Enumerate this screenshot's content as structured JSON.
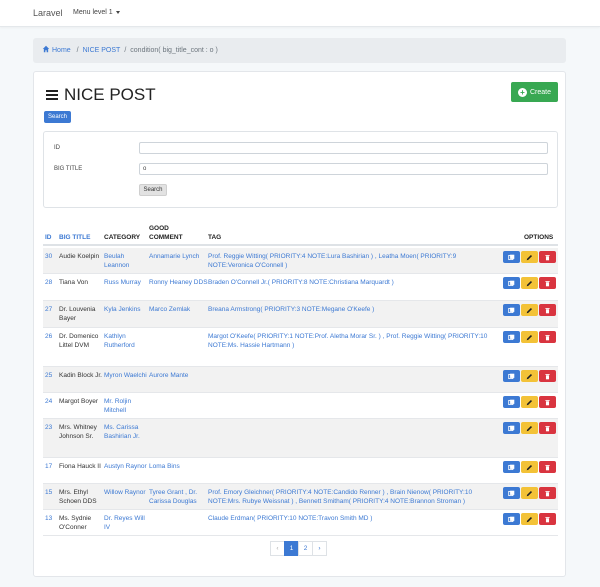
{
  "navbar": {
    "brand": "Laravel",
    "menu_label": "Menu level 1"
  },
  "breadcrumb": {
    "home": "Home",
    "page": "NICE POST",
    "current": "condition( big_title_cont : o )"
  },
  "header": {
    "title": "NICE POST",
    "create_label": "Create",
    "search_toggle_label": "Search"
  },
  "filter": {
    "id_label": "ID",
    "id_value": "",
    "big_title_label": "BIG TITLE",
    "big_title_value": "o",
    "search_button": "Search"
  },
  "table": {
    "headers": {
      "id": "ID",
      "big_title": "BIG TITLE",
      "category": "CATEGORY",
      "good_comment": "GOOD COMMENT",
      "tag": "TAG",
      "options": "OPTIONS"
    },
    "rows": [
      {
        "id": "30",
        "title": "Audie Koelpin",
        "category": "Beulah Leannon",
        "comment": "Annamarie Lynch",
        "tag": "Prof. Reggie Witting( PRIORITY:4 NOTE:Lura Bashirian ) , Leatha Moen( PRIORITY:9 NOTE:Veronica O'Connell )"
      },
      {
        "id": "28",
        "title": "Tiana Von",
        "category": "Russ Murray",
        "comment": "Ronny Heaney DDS",
        "tag": "Braden O'Connell Jr.( PRIORITY:8 NOTE:Christiana Marquardt )"
      },
      {
        "id": "27",
        "title": "Dr. Louvenia Bayer",
        "category": "Kyla Jenkins",
        "comment": "Marco Zemlak",
        "tag": "Breana Armstrong( PRIORITY:3 NOTE:Megane O'Keefe )"
      },
      {
        "id": "26",
        "title": "Dr. Domenico Littel DVM",
        "category": "Kathlyn Rutherford",
        "comment": "",
        "tag": "Margot O'Keefe( PRIORITY:1 NOTE:Prof. Aletha Morar Sr. ) , Prof. Reggie Witting( PRIORITY:10 NOTE:Ms. Hassie Hartmann )"
      },
      {
        "id": "25",
        "title": "Kadin Block Jr.",
        "category": "Myron Waelchi",
        "comment": "Aurore Mante",
        "tag": ""
      },
      {
        "id": "24",
        "title": "Margot Boyer",
        "category": "Mr. Roljin Mitchell",
        "comment": "",
        "tag": ""
      },
      {
        "id": "23",
        "title": "Mrs. Whitney Johnson Sr.",
        "category": "Ms. Carissa Bashirian Jr.",
        "comment": "",
        "tag": ""
      },
      {
        "id": "17",
        "title": "Fiona Hauck II",
        "category": "Austyn Raynor",
        "comment": "Loma Bins",
        "tag": ""
      },
      {
        "id": "15",
        "title": "Mrs. Ethyl Schoen DDS",
        "category": "Willow Raynor",
        "comment": "Tyree Grant , Dr. Carissa Douglas",
        "tag": "Prof. Emory Gleichner( PRIORITY:4 NOTE:Candido Renner ) , Brain Nienow( PRIORITY:10 NOTE:Mrs. Rubye Weissnat ) , Bennett Smitham( PRIORITY:4 NOTE:Brannon Stroman )"
      },
      {
        "id": "13",
        "title": "Ms. Sydnie O'Conner",
        "category": "Dr. Reyes Will IV",
        "comment": "",
        "tag": "Claude Erdman( PRIORITY:10 NOTE:Travon Smith MD )"
      }
    ]
  },
  "pagination": {
    "prev": "‹",
    "pages": [
      "1",
      "2"
    ],
    "next": "›",
    "active": "1"
  },
  "colors": {
    "primary": "#3c79d3",
    "success": "#38a852",
    "warning": "#f3c237",
    "danger": "#d9343f"
  }
}
